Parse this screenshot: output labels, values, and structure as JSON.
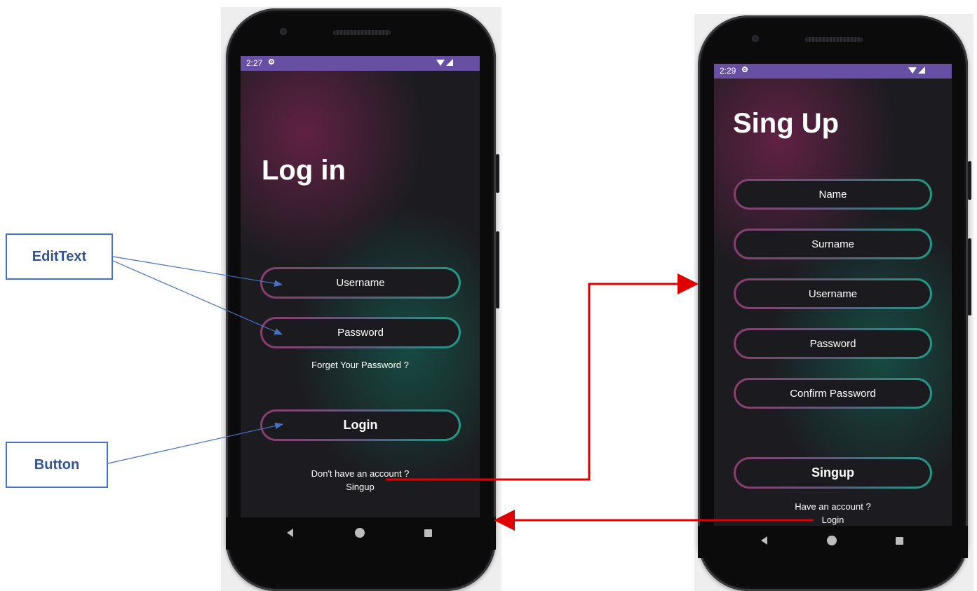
{
  "annotations": {
    "edittext_label": "EditText",
    "button_label": "Button"
  },
  "login_screen": {
    "status_time": "2:27",
    "title": "Log in",
    "username_placeholder": "Username",
    "password_placeholder": "Password",
    "forgot_password": "Forget Your Password ?",
    "login_button": "Login",
    "no_account_text": "Don't have an account ?",
    "signup_link": "Singup"
  },
  "signup_screen": {
    "status_time": "2:29",
    "title": "Sing Up",
    "name_placeholder": "Name",
    "surname_placeholder": "Surname",
    "username_placeholder": "Username",
    "password_placeholder": "Password",
    "confirm_password_placeholder": "Confirm Password",
    "signup_button": "Singup",
    "have_account_text": "Have an account ?",
    "login_link": "Login"
  },
  "colors": {
    "status_bar": "#6750a4",
    "annotation_blue": "#4472c4",
    "flow_arrow_red": "#e00000",
    "pill_gradient_start": "#8a3e6e",
    "pill_gradient_end": "#1f9a85"
  }
}
